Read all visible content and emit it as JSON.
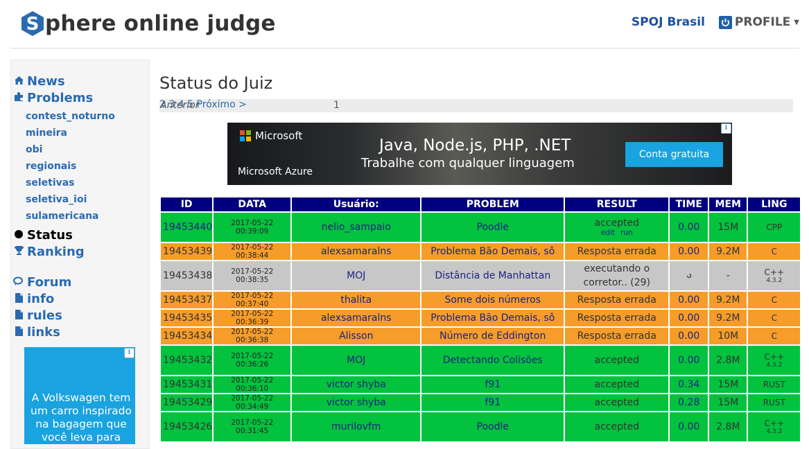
{
  "header": {
    "logo_text": "phere online judge",
    "logo_letter": "S",
    "nav_brasil": "SPOJ Brasil",
    "nav_profile": "PROFILE"
  },
  "sidebar": {
    "news": "News",
    "problems": "Problems",
    "sub": [
      "contest_noturno",
      "mineira",
      "obi",
      "regionais",
      "seletivas",
      "seletiva_ioi",
      "sulamericana"
    ],
    "status": "Status",
    "ranking": "Ranking",
    "forum": "Forum",
    "info": "info",
    "rules": "rules",
    "links": "links",
    "ad_text": "A Volkswagen tem um carro inspirado na bagagem que você leva para"
  },
  "page": {
    "title": "Status do Juiz",
    "pager": {
      "prev": "Anterior",
      "pages": [
        "1",
        "2",
        "3",
        "4",
        "5"
      ],
      "next": "Próximo >"
    }
  },
  "banner": {
    "brand": "Microsoft",
    "product": "Microsoft Azure",
    "headline": "Java, Node.js, PHP, .NET",
    "subline": "Trabalhe com qualquer linguagem",
    "cta": "Conta gratuita"
  },
  "table": {
    "headers": [
      "ID",
      "DATA",
      "Usuário:",
      "PROBLEM",
      "RESULT",
      "TIME",
      "MEM",
      "LING"
    ],
    "rows": [
      {
        "status": "g",
        "id": "19453440",
        "date": "2017-05-22 00:39:09",
        "user": "nelio_sampaio",
        "problem": "Poodle",
        "result": "accepted",
        "actions": [
          "edit",
          "run"
        ],
        "time": "0.00",
        "mem": "15M",
        "lang": "CPP",
        "lang_ver": ""
      },
      {
        "status": "o",
        "id": "19453439",
        "date": "2017-05-22 00:38:44",
        "user": "alexsamaralns",
        "problem": "Problema Bão Demais, sô",
        "result": "Resposta errada",
        "actions": [],
        "time": "0.00",
        "mem": "9.2M",
        "lang": "C",
        "lang_ver": ""
      },
      {
        "status": "s",
        "id": "19453438",
        "date": "2017-05-22 00:38:35",
        "user": "MOJ",
        "problem": "Distância de Manhattan",
        "result": "executando o corretor.. (29)",
        "actions": [],
        "time": "",
        "mem": "-",
        "lang": "C++",
        "lang_ver": "4.3.2"
      },
      {
        "status": "o",
        "id": "19453437",
        "date": "2017-05-22 00:37:40",
        "user": "thalita",
        "problem": "Some dois números",
        "result": "Resposta errada",
        "actions": [],
        "time": "0.00",
        "mem": "9.2M",
        "lang": "C",
        "lang_ver": ""
      },
      {
        "status": "o",
        "id": "19453435",
        "date": "2017-05-22 00:36:39",
        "user": "alexsamaralns",
        "problem": "Problema Bão Demais, sô",
        "result": "Resposta errada",
        "actions": [],
        "time": "0.00",
        "mem": "9.2M",
        "lang": "C",
        "lang_ver": ""
      },
      {
        "status": "o",
        "id": "19453434",
        "date": "2017-05-22 00:36:38",
        "user": "Alisson",
        "problem": "Número de Eddington",
        "result": "Resposta errada",
        "actions": [],
        "time": "0.00",
        "mem": "10M",
        "lang": "C",
        "lang_ver": ""
      },
      {
        "status": "g",
        "id": "19453432",
        "date": "2017-05-22 00:36:26",
        "user": "MOJ",
        "problem": "Detectando Colisões",
        "result": "accepted",
        "actions": [],
        "time": "0.00",
        "mem": "2.8M",
        "lang": "C++",
        "lang_ver": "4.3.2"
      },
      {
        "status": "g",
        "id": "19453431",
        "date": "2017-05-22 00:36:10",
        "user": "victor shyba",
        "problem": "f91",
        "result": "accepted",
        "actions": [],
        "time": "0.34",
        "mem": "15M",
        "lang": "RUST",
        "lang_ver": ""
      },
      {
        "status": "g",
        "id": "19453429",
        "date": "2017-05-22 00:34:49",
        "user": "victor shyba",
        "problem": "f91",
        "result": "accepted",
        "actions": [],
        "time": "0.28",
        "mem": "15M",
        "lang": "RUST",
        "lang_ver": ""
      },
      {
        "status": "g",
        "id": "19453426",
        "date": "2017-05-22 00:31:45",
        "user": "murilovfm",
        "problem": "Poodle",
        "result": "accepted",
        "actions": [],
        "time": "0.00",
        "mem": "2.8M",
        "lang": "C++",
        "lang_ver": "4.3.2"
      }
    ]
  },
  "colors": {
    "accepted": "#03c23e",
    "wrong": "#f59c2a",
    "running": "#c7c7c7",
    "header": "#000080",
    "link": "#2a6ab0"
  }
}
